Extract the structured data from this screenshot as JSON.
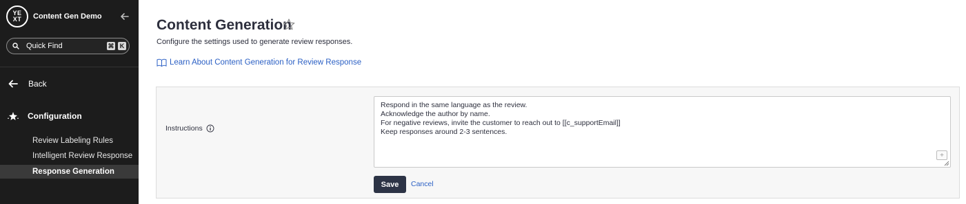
{
  "app": {
    "logo_text_top": "YE",
    "logo_text_bottom": "XT",
    "name": "Content Gen Demo"
  },
  "sidebar": {
    "search": {
      "placeholder": "Quick Find",
      "shortcut_cmd": "⌘",
      "shortcut_key": "K"
    },
    "back_label": "Back",
    "section_title": "Configuration",
    "items": [
      {
        "label": "Review Labeling Rules",
        "active": false
      },
      {
        "label": "Intelligent Review Response",
        "active": false
      },
      {
        "label": "Response Generation",
        "active": true
      }
    ]
  },
  "main": {
    "title": "Content Generation",
    "subtitle": "Configure the settings used to generate review responses.",
    "learn_link": "Learn About Content Generation for Review Response",
    "instructions": {
      "label": "Instructions",
      "lines": [
        "Respond in the same language as the review.",
        "Acknowledge the author by name.",
        "For negative reviews, invite the customer to reach out to [[c_supportEmail]]",
        "Keep responses around 2-3 sentences."
      ]
    },
    "save_label": "Save",
    "cancel_label": "Cancel"
  },
  "colors": {
    "sidebar_bg": "#1c1c1c",
    "active_item_bg": "#3a3a3a",
    "link": "#2a5fc4",
    "primary_button": "#2d3446"
  }
}
